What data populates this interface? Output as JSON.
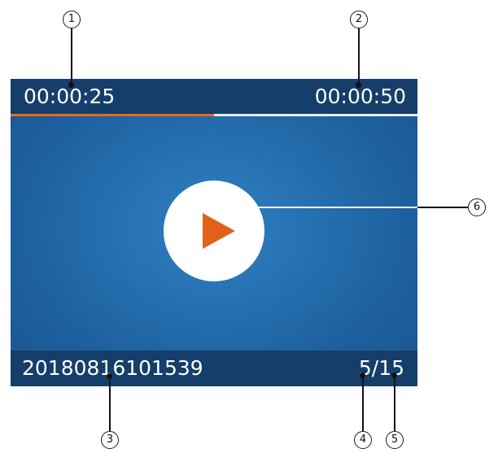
{
  "player": {
    "elapsed_time": "00:00:25",
    "total_time": "00:00:50",
    "progress_percent": 50,
    "filename": "20180816101539",
    "file_counter": "5/15",
    "play_icon": "play-icon"
  },
  "callouts": [
    "1",
    "2",
    "3",
    "4",
    "5",
    "6"
  ],
  "colors": {
    "bar_background": "#163e6a",
    "screen_blue": "#2670b0",
    "progress_accent": "#e86a1c",
    "play_triangle": "#e0621a"
  }
}
